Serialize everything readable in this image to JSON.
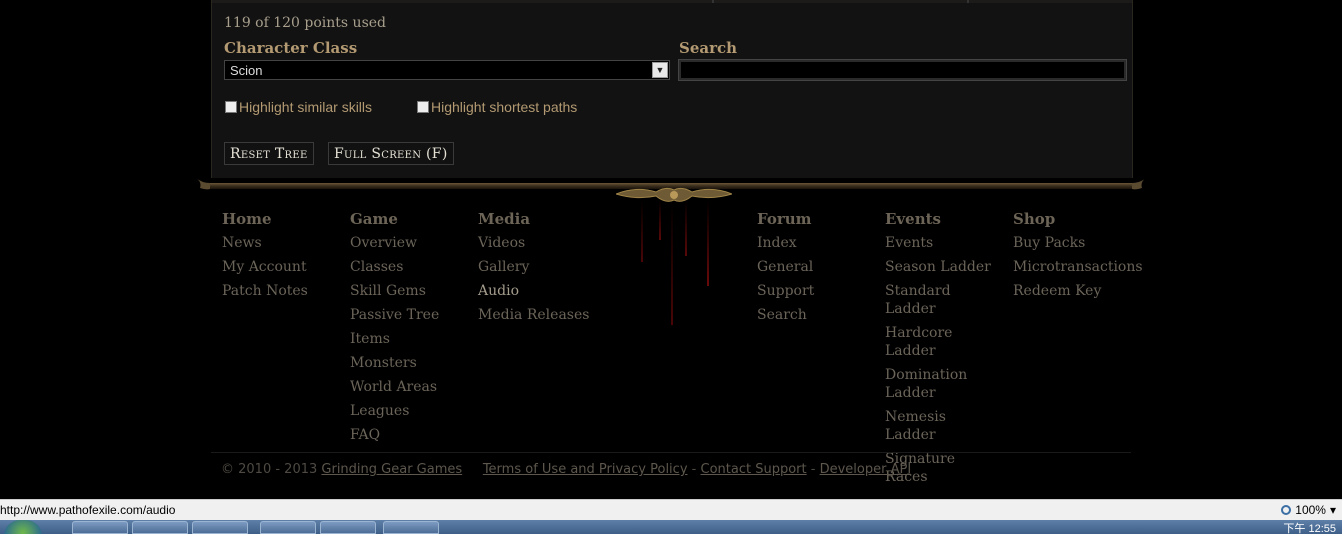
{
  "tree": {
    "points_used": "119 of 120 points used",
    "class_label": "Character Class",
    "class_value": "Scion",
    "search_label": "Search",
    "search_value": "",
    "highlight_similar": "Highlight similar skills",
    "highlight_paths": "Highlight shortest paths",
    "reset_label": "Reset Tree",
    "fullscreen_label": "Full Screen (F)"
  },
  "footer": {
    "columns": [
      {
        "title": "Home",
        "links": [
          "News",
          "My Account",
          "Patch Notes"
        ]
      },
      {
        "title": "Game",
        "links": [
          "Overview",
          "Classes",
          "Skill Gems",
          "Passive Tree",
          "Items",
          "Monsters",
          "World Areas",
          "Leagues",
          "FAQ"
        ]
      },
      {
        "title": "Media",
        "links": [
          "Videos",
          "Gallery",
          "Audio",
          "Media Releases"
        ]
      },
      {
        "title": "Forum",
        "links": [
          "Index",
          "General",
          "Support",
          "Search"
        ]
      },
      {
        "title": "Events",
        "links": [
          "Events",
          "Season Ladder",
          "Standard Ladder",
          "Hardcore Ladder",
          "Domination Ladder",
          "Nemesis Ladder",
          "Signature Races"
        ]
      },
      {
        "title": "Shop",
        "links": [
          "Buy Packs",
          "Microtransactions",
          "Redeem Key"
        ]
      }
    ],
    "copyright": "© 2010 - 2013",
    "company": "Grinding Gear Games",
    "terms": "Terms of Use and Privacy Policy",
    "contact": "Contact Support",
    "api": "Developer API",
    "sep": "-"
  },
  "status": {
    "url": "http://www.pathofexile.com/audio",
    "zoom": "100%"
  },
  "taskbar": {
    "clock": "下午 12:55"
  }
}
